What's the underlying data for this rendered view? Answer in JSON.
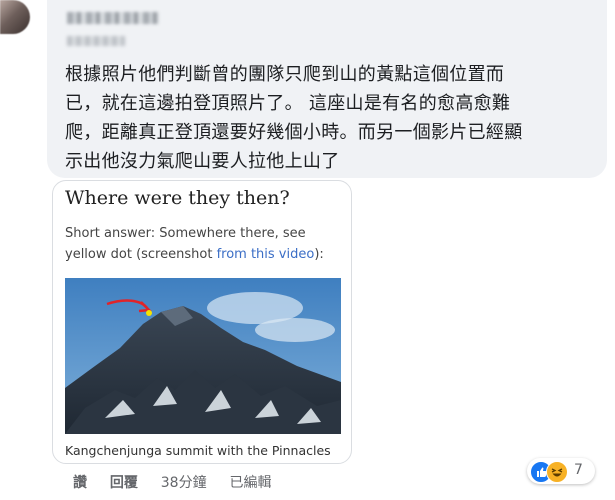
{
  "comment": {
    "text_lines": [
      "根據照片他們判斷曾的團隊只爬到山的黃點這個位置而",
      "已，就在這邊拍登頂照片了。 這座山是有名的愈高愈難",
      "爬，距離真正登頂還要好幾個小時。而另一個影片已經顯",
      "示出他沒力氣爬山要人拉他上山了"
    ]
  },
  "preview": {
    "title": "Where were they then?",
    "answer_prefix": "Short answer: Somewhere there, see yellow dot (screenshot ",
    "answer_link": "from this video",
    "answer_suffix": "):",
    "caption": "Kangchenjunga summit with the Pinnacles"
  },
  "actions": {
    "like": "讚",
    "reply": "回覆",
    "time": "38分鐘",
    "edited": "已編輯"
  },
  "reactions": {
    "count": "7",
    "icons": [
      "like-icon",
      "haha-icon"
    ]
  },
  "colors": {
    "bubble": "#f0f2f5",
    "link": "#3b6ec6",
    "like": "#1877f2",
    "haha": "#f7b125"
  }
}
